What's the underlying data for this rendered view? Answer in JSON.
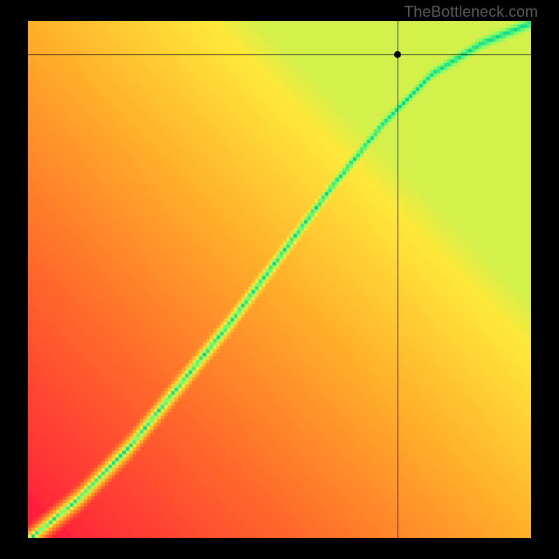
{
  "watermark": "TheBottleneck.com",
  "chart_data": {
    "type": "heatmap",
    "title": "",
    "xlabel": "",
    "ylabel": "",
    "xlim": [
      0,
      1
    ],
    "ylim": [
      0,
      1
    ],
    "crosshair": {
      "x": 0.735,
      "y": 0.935
    },
    "ridge_points": [
      {
        "x": 0.0,
        "y": 0.0
      },
      {
        "x": 0.1,
        "y": 0.08
      },
      {
        "x": 0.2,
        "y": 0.18
      },
      {
        "x": 0.3,
        "y": 0.3
      },
      {
        "x": 0.4,
        "y": 0.42
      },
      {
        "x": 0.5,
        "y": 0.55
      },
      {
        "x": 0.6,
        "y": 0.68
      },
      {
        "x": 0.7,
        "y": 0.8
      },
      {
        "x": 0.8,
        "y": 0.9
      },
      {
        "x": 0.9,
        "y": 0.96
      },
      {
        "x": 1.0,
        "y": 1.0
      }
    ],
    "ridge_width": 0.055,
    "color_stops": [
      {
        "t": 0.0,
        "color": "#ff1a3c"
      },
      {
        "t": 0.3,
        "color": "#ff6a2a"
      },
      {
        "t": 0.55,
        "color": "#ffb02a"
      },
      {
        "t": 0.75,
        "color": "#ffe83a"
      },
      {
        "t": 0.9,
        "color": "#7dff6a"
      },
      {
        "t": 1.0,
        "color": "#00d68f"
      }
    ]
  }
}
